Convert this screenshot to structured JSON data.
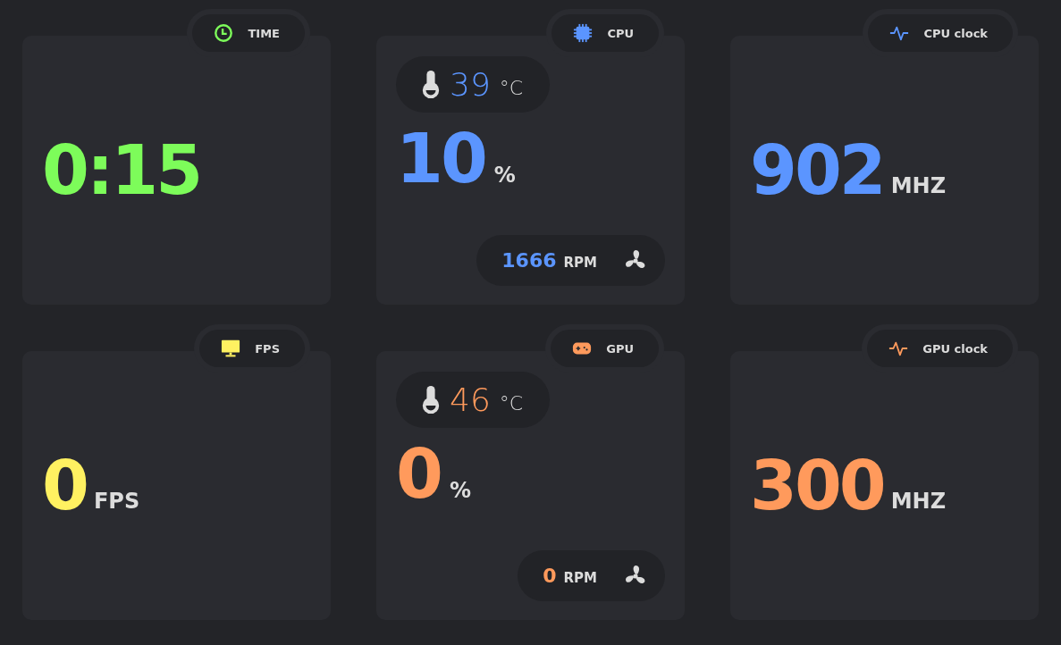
{
  "cards": [
    {
      "kind": "time",
      "label": "TIME",
      "color": "#7dfc5a",
      "value": "0:15"
    },
    {
      "kind": "cpu",
      "label": "CPU",
      "color": "#5b95ff",
      "temp": "39",
      "temp_unit": "°C",
      "value": "10",
      "unit": "%",
      "fan": "1666",
      "fan_unit": "RPM"
    },
    {
      "kind": "clock",
      "label": "CPU clock",
      "color": "#5b95ff",
      "value": "902",
      "unit": "MHZ"
    },
    {
      "kind": "fps",
      "label": "FPS",
      "color": "#fff161",
      "value": "0",
      "unit": "FPS"
    },
    {
      "kind": "gpu",
      "label": "GPU",
      "color": "#ff9a5c",
      "temp": "46",
      "temp_unit": "°C",
      "value": "0",
      "unit": "%",
      "fan": "0",
      "fan_unit": "RPM"
    },
    {
      "kind": "clock",
      "label": "GPU clock",
      "color": "#ff9a5c",
      "value": "300",
      "unit": "MHZ"
    }
  ]
}
